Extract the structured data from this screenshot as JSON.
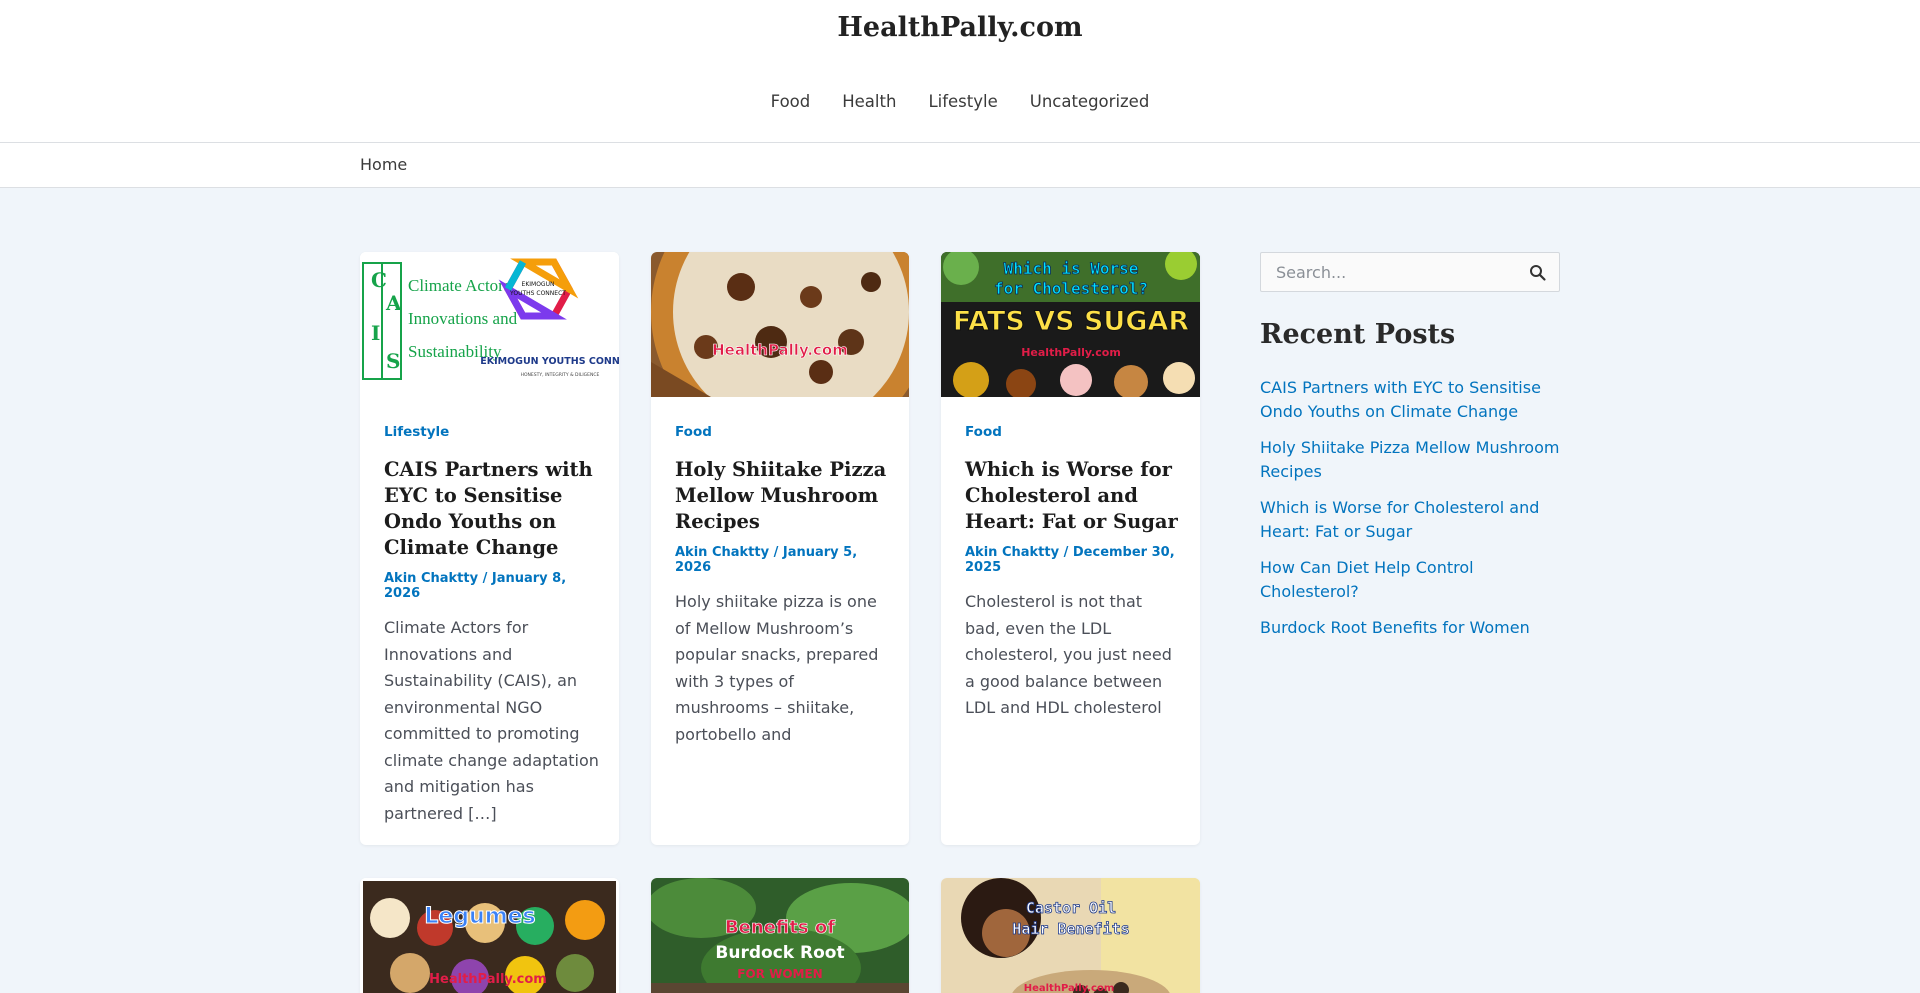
{
  "site": {
    "title": "HealthPally.com"
  },
  "nav": [
    "Food",
    "Health",
    "Lifestyle",
    "Uncategorized"
  ],
  "breadcrumb": "Home",
  "posts": [
    {
      "category": "Lifestyle",
      "title": "CAIS Partners with EYC to Sensitise Ondo Youths on Climate Change",
      "author": "Akin Chaktty",
      "date": "January 8, 2026",
      "excerpt": "Climate Actors for Innovations and Sustainability (CAIS), an environmental NGO committed to promoting climate change adaptation and mitigation has partnered […]",
      "image_text": {
        "logo_letters": "CAIS",
        "logo_line1": "Climate Actors for",
        "logo_line2": "Innovations and",
        "logo_line3": "Sustainability",
        "badge_line1": "EKIMOGUN",
        "badge_line2": "YOUTHS CONNECT",
        "badge_name": "EKIMOGUN YOUTHS CONNECT",
        "badge_tagline": "HONESTY, INTEGRITY & DILIGENCE"
      }
    },
    {
      "category": "Food",
      "title": "Holy Shiitake Pizza Mellow Mushroom Recipes",
      "author": "Akin Chaktty",
      "date": "January 5, 2026",
      "excerpt": "Holy shiitake pizza is one of Mellow Mushroom’s popular snacks, prepared with 3 types of mushrooms – shiitake, portobello and",
      "image_text": {
        "watermark": "HealthPally.com"
      }
    },
    {
      "category": "Food",
      "title": "Which is Worse for Cholesterol and Heart: Fat or Sugar",
      "author": "Akin Chaktty",
      "date": "December 30, 2025",
      "excerpt": "Cholesterol is not that bad, even the LDL cholesterol, you just need a good balance between LDL and HDL cholesterol",
      "image_text": {
        "line1": "Which is Worse",
        "line2": "for Cholesterol?",
        "line3": "FATS VS SUGAR",
        "watermark": "HealthPally.com"
      }
    }
  ],
  "more_posts_images": [
    {
      "line1": "Legumes",
      "watermark": "HealthPally.com"
    },
    {
      "line1": "Benefits of",
      "line2": "Burdock Root",
      "line3": "FOR WOMEN"
    },
    {
      "line1": "Castor Oil",
      "line2": "Hair Benefits",
      "watermark": "HealthPally.com"
    }
  ],
  "sidebar": {
    "search_placeholder": "Search...",
    "recent_title": "Recent Posts",
    "recent_posts": [
      "CAIS Partners with EYC to Sensitise Ondo Youths on Climate Change",
      "Holy Shiitake Pizza Mellow Mushroom Recipes",
      "Which is Worse for Cholesterol and Heart: Fat or Sugar",
      "How Can Diet Help Control Cholesterol?",
      "Burdock Root Benefits for Women"
    ]
  },
  "colors": {
    "link": "#0274be",
    "background": "#f0f5fa",
    "card": "#ffffff"
  },
  "icons": {
    "search": "search-icon"
  }
}
